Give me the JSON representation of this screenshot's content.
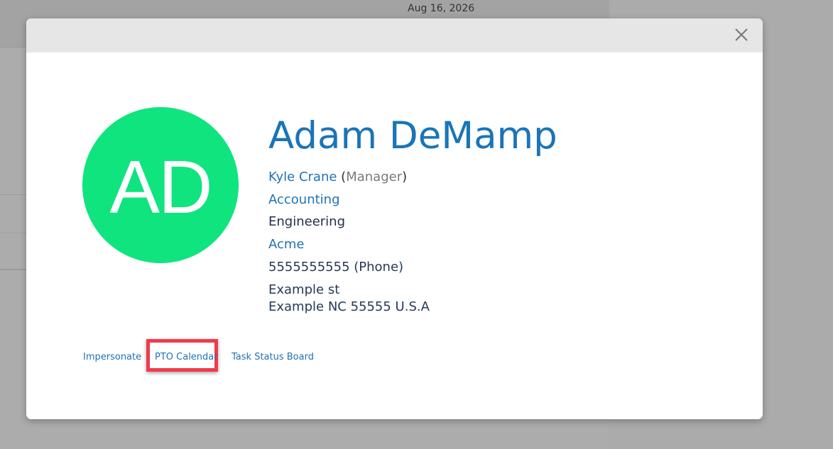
{
  "background": {
    "date": "Aug 16, 2026"
  },
  "modal": {
    "close_icon": "close-icon",
    "avatar": {
      "initials": "AD",
      "color": "#0fe47f"
    },
    "profile": {
      "name": "Adam DeMamp",
      "manager": {
        "name": "Kyle Crane",
        "open_paren": "(",
        "role": "Manager",
        "close_paren": ")"
      },
      "department": "Accounting",
      "team": "Engineering",
      "company": "Acme",
      "phone": "5555555555 (Phone)",
      "address_line1": "Example st",
      "address_line2": "Example NC 55555 U.S.A"
    },
    "actions": {
      "impersonate": "Impersonate",
      "pto_calendar": "PTO Calendar",
      "task_status_board": "Task Status Board"
    },
    "highlight_color": "#f2394a",
    "accent_color": "#1a74b8"
  }
}
